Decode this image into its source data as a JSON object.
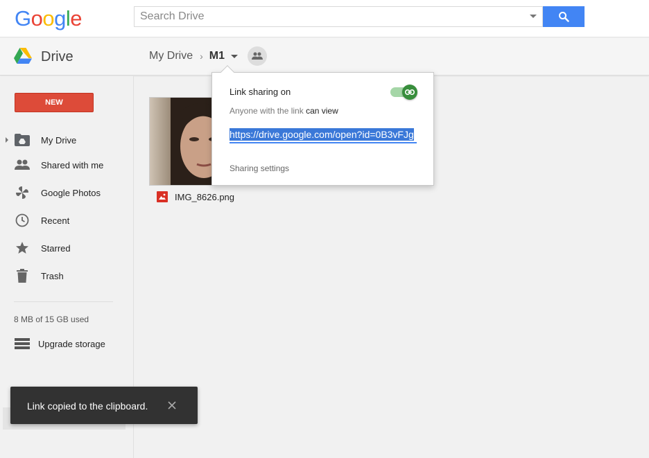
{
  "header": {
    "logo_text": "Google",
    "search": {
      "placeholder": "Search Drive",
      "value": ""
    }
  },
  "subheader": {
    "app_title": "Drive",
    "breadcrumb": {
      "parent": "My Drive",
      "current": "M1"
    }
  },
  "sidebar": {
    "new_label": "NEW",
    "items": [
      {
        "label": "My Drive",
        "icon": "my-drive-folder-icon"
      },
      {
        "label": "Shared with me",
        "icon": "shared-people-icon"
      },
      {
        "label": "Google Photos",
        "icon": "photos-pinwheel-icon"
      },
      {
        "label": "Recent",
        "icon": "clock-icon"
      },
      {
        "label": "Starred",
        "icon": "star-icon"
      },
      {
        "label": "Trash",
        "icon": "trash-icon"
      }
    ],
    "storage_text": "8 MB of 15 GB used",
    "upgrade_label": "Upgrade storage"
  },
  "files": [
    {
      "name": "IMG_8626.png",
      "type_icon": "image-file-icon"
    }
  ],
  "share_popup": {
    "title": "Link sharing on",
    "access_prefix": "Anyone with the link",
    "access_level": "can view",
    "link_url": "https://drive.google.com/open?id=0B3vFJg",
    "settings_label": "Sharing settings",
    "toggle_on": true
  },
  "snackbar": {
    "message": "Link copied to the clipboard."
  },
  "colors": {
    "google_blue": "#4285f4",
    "google_red": "#ea4335",
    "google_yellow": "#fbbc05",
    "google_green": "#34a853",
    "new_button": "#dd4b39",
    "toggle_green": "#388e3c"
  }
}
